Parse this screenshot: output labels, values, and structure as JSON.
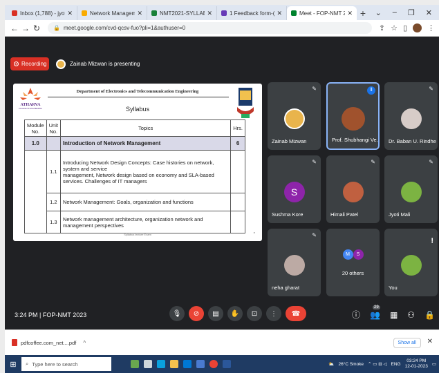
{
  "browser": {
    "tabs": [
      {
        "title": "Inbox (1,788) - jyotimali@ati",
        "icon_color": "#d93025",
        "active": false
      },
      {
        "title": "Network Management in Tel",
        "icon_color": "#f9ab00",
        "active": false
      },
      {
        "title": "NMT2021-SYLLABUS-REVISE",
        "icon_color": "#188038",
        "active": false
      },
      {
        "title": "1 Feedback form-(FDP) for t",
        "icon_color": "#673ab7",
        "active": false
      },
      {
        "title": "Meet - FOP-NMT 2023",
        "icon_color": "#00832d",
        "active": true
      }
    ],
    "url": "meet.google.com/cvd-qcsv-fuo?pli=1&authuser=0"
  },
  "meet": {
    "recording_label": "Recording",
    "presenter_label": "Zainab Mizwan is presenting",
    "time": "3:24 PM",
    "meeting_name": "FOP-NMT 2023",
    "participant_count": "29"
  },
  "slide": {
    "department": "Department of Electronics and Telecommunication Engineering",
    "logo_text": "ATHARVA",
    "logo_subtext": "COLLEGE OF ENGINEERING",
    "title": "Syllabus",
    "headers": {
      "module": "Module No.",
      "unit": "Unit No.",
      "topics": "Topics",
      "hrs": "Hrs."
    },
    "module_row": {
      "module": "1.0",
      "topic": "Introduction of Network Management",
      "hrs": "6"
    },
    "units": [
      {
        "unit": "1.1",
        "line1": "Introducing Network Design Concepts: Case histories on network, system and service",
        "line2": "management, Network design based on economy and SLA-based services. Challenges of IT managers"
      },
      {
        "unit": "1.2",
        "line1": "Network Management: Goals, organization and functions",
        "line2": ""
      },
      {
        "unit": "1.3",
        "line1": "Network management architecture, organization network and management perspectives",
        "line2": ""
      }
    ],
    "footer": "Syllabus lecture Exam",
    "page": "7"
  },
  "participants": [
    {
      "name": "Zainab Mizwan",
      "initial": "",
      "color": "#e9b44c"
    },
    {
      "name": "Prof. Shubhangi Ve...",
      "initial": "",
      "color": "#a0522d"
    },
    {
      "name": "Dr. Baban U. Rindhe",
      "initial": "",
      "color": "#d7ccc8"
    },
    {
      "name": "Sushma Kore",
      "initial": "S",
      "color": "#8e24aa"
    },
    {
      "name": "Himali Patel",
      "initial": "",
      "color": "#c06040"
    },
    {
      "name": "Jyoti Mali",
      "initial": "",
      "color": "#7cb342"
    },
    {
      "name": "neha gharat",
      "initial": "",
      "color": "#bcaaa4"
    },
    {
      "name": "20 others",
      "initial": "",
      "color": "#00897b"
    },
    {
      "name": "You",
      "initial": "",
      "color": "#7cb342"
    }
  ],
  "others_avatars": [
    {
      "initial": "M",
      "color": "#4285f4"
    },
    {
      "initial": "S",
      "color": "#8e24aa"
    }
  ],
  "download": {
    "file": "pdfcoffee.com_net....pdf",
    "show_all": "Show all"
  },
  "taskbar": {
    "search_placeholder": "Type here to search",
    "weather": "26°C Smoke",
    "lang": "ENG",
    "time": "03:24 PM",
    "date": "12-01-2023"
  }
}
